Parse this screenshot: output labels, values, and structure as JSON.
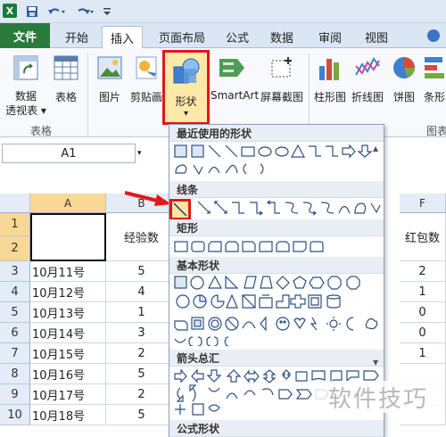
{
  "tabs": [
    "文件",
    "开始",
    "插入",
    "页面布局",
    "公式",
    "数据",
    "审阅",
    "视图"
  ],
  "ribbon": {
    "pivot": "数据",
    "pivot2": "透视表",
    "table": "表格",
    "picture": "图片",
    "clipart": "剪贴画",
    "shapes": "形状",
    "smartart": "SmartArt",
    "screenshot": "屏幕截图",
    "column": "柱形图",
    "line": "折线图",
    "pie": "饼图",
    "bar": "条形",
    "group_tables": "表格",
    "group_charts": "图表"
  },
  "namebox": "A1",
  "columns": [
    "A",
    "B",
    "F"
  ],
  "rows": [
    "1",
    "2",
    "3",
    "4",
    "5",
    "6",
    "7",
    "8",
    "9",
    "10"
  ],
  "headers": {
    "b": "经验数",
    "f": "红包数"
  },
  "data": [
    {
      "a": "10月11号",
      "b": "5",
      "f": "2"
    },
    {
      "a": "10月12号",
      "b": "4",
      "f": "1"
    },
    {
      "a": "10月13号",
      "b": "1",
      "f": "0"
    },
    {
      "a": "10月14号",
      "b": "3",
      "f": "0"
    },
    {
      "a": "10月15号",
      "b": "2",
      "f": "1"
    },
    {
      "a": "10月16号",
      "b": "5",
      "f": ""
    },
    {
      "a": "10月17号",
      "b": "2",
      "f": ""
    },
    {
      "a": "10月18号",
      "b": "5",
      "f": ""
    }
  ],
  "dropdown": {
    "recent": "最近使用的形状",
    "lines": "线条",
    "rect": "矩形",
    "basic": "基本形状",
    "arrows": "箭头总汇",
    "formula": "公式形状"
  },
  "watermark": "软件技巧"
}
